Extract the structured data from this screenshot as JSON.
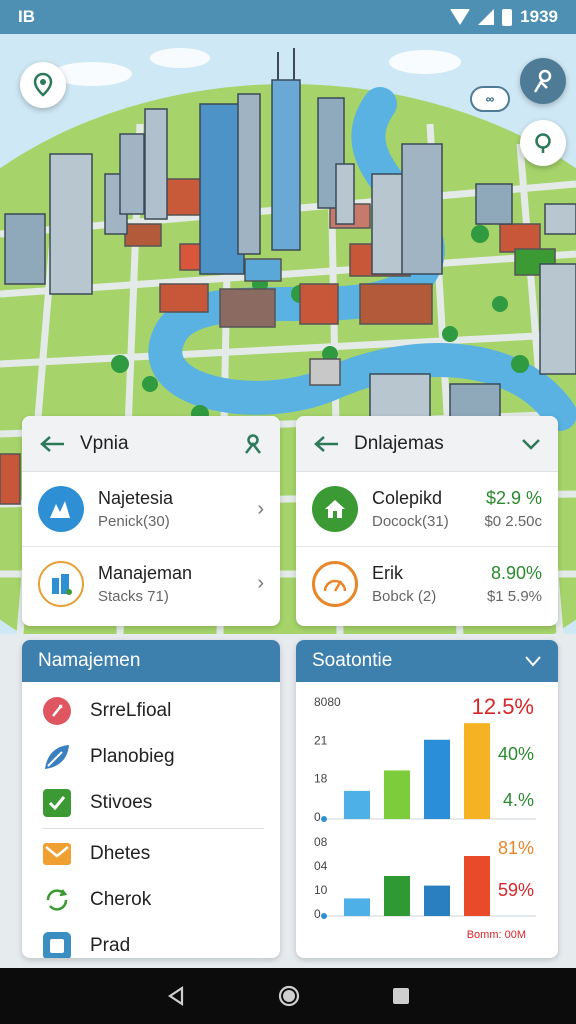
{
  "status": {
    "left": "IB",
    "time": "1939"
  },
  "left_card": {
    "title": "Vpnia",
    "items": [
      {
        "title": "Najetesia",
        "sub": "Penick(30)",
        "color": "#2f8fd4",
        "icon": "chart-icon"
      },
      {
        "title": "Manajeman",
        "sub": "Stacks 71)",
        "color": "#e6a23a",
        "icon": "building-icon"
      }
    ]
  },
  "right_card": {
    "title": "Dnlajemas",
    "items": [
      {
        "title": "Colepikd",
        "sub": "Docock(31)",
        "value": "$2.9 %",
        "sub_value": "$0 2.50c",
        "color": "#3c9a34",
        "icon": "house-icon"
      },
      {
        "title": "Erik",
        "sub": "Bobck (2)",
        "value": "8.90%",
        "sub_value": "$1 5.9%",
        "color": "#e8862a",
        "icon": "gauge-icon"
      }
    ]
  },
  "menu_panel": {
    "title": "Namajemen",
    "items": [
      {
        "label": "SrreLfioal",
        "color": "#e05660",
        "icon": "location-icon"
      },
      {
        "label": "Planobieg",
        "color": "#3a7fc0",
        "icon": "leaf-icon"
      },
      {
        "label": "Stivoes",
        "color": "#3c9a34",
        "icon": "check-icon"
      },
      {
        "label": "Dhetes",
        "color": "#f0a030",
        "icon": "mail-icon"
      },
      {
        "label": "Cherok",
        "color": "#3c9a34",
        "icon": "refresh-icon"
      },
      {
        "label": "Prad",
        "color": "#3a8fc0",
        "icon": "document-icon"
      }
    ]
  },
  "chart_panel": {
    "title": "Soatontie",
    "chart_data": [
      {
        "type": "bar",
        "ytick_labels": [
          "8080",
          "21",
          "18",
          "0"
        ],
        "values": [
          22,
          38,
          62,
          75
        ],
        "ylim": [
          0,
          90
        ],
        "colors": [
          "#4db0e6",
          "#7dcc3c",
          "#2a8fd8",
          "#f5b324"
        ],
        "annotations": [
          {
            "text": "12.5%",
            "color": "#d8262a"
          },
          {
            "text": "40%",
            "color": "#2a8a2e"
          },
          {
            "text": "4.%",
            "color": "#2a8a2e"
          }
        ]
      },
      {
        "type": "bar",
        "ytick_labels": [
          "08",
          "04",
          "10",
          "0"
        ],
        "values": [
          22,
          50,
          38,
          75
        ],
        "ylim": [
          0,
          90
        ],
        "colors": [
          "#4db0e6",
          "#2f9a34",
          "#2a7fc0",
          "#e84a2a"
        ],
        "annotations": [
          {
            "text": "81%",
            "color": "#e8862a"
          },
          {
            "text": "59%",
            "color": "#d8262a"
          }
        ],
        "footer": "Bomm: 00M"
      }
    ]
  }
}
